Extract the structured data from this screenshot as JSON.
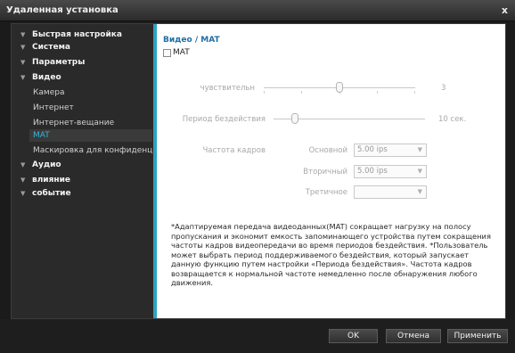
{
  "window": {
    "title": "Удаленная установка",
    "close_glyph": "x"
  },
  "sidebar": {
    "items": [
      {
        "label": "Быстрая настройка",
        "type": "category"
      },
      {
        "label": "Система",
        "type": "category"
      },
      {
        "label": "Параметры",
        "type": "category"
      },
      {
        "label": "Видео",
        "type": "category"
      },
      {
        "label": "Камера",
        "type": "sub"
      },
      {
        "label": "Интернет",
        "type": "sub"
      },
      {
        "label": "Интернет-вещание",
        "type": "sub"
      },
      {
        "label": "MAT",
        "type": "sub",
        "selected": true
      },
      {
        "label": "Маскировка для конфиденци",
        "type": "sub"
      },
      {
        "label": "Аудио",
        "type": "category"
      },
      {
        "label": "влияние",
        "type": "category"
      },
      {
        "label": "событие",
        "type": "category"
      }
    ]
  },
  "main": {
    "heading": "Видео / MAT",
    "mat_checkbox": {
      "label": "MAT",
      "checked": false
    },
    "sensitivity": {
      "label": "чувствительн",
      "value": "3",
      "level": 3,
      "min": 1,
      "max": 5
    },
    "idle_period": {
      "label": "Период бездействия",
      "value": "10",
      "unit": "сек.",
      "level": 10,
      "min": 10,
      "max": 300
    },
    "frame_rate": {
      "label": "Частота кадров",
      "primary": {
        "label": "Основной",
        "value": "5.00 ips"
      },
      "secondary": {
        "label": "Вторичный",
        "value": "5.00 ips"
      },
      "tertiary": {
        "label": "Третичное",
        "value": ""
      }
    },
    "note": "*Адаптируемая передача видеоданных(MAT) сокращает нагрузку на полосу пропускания и экономит емкость запоминающего устройства путем сокращения частоты кадров видеопередачи во время периодов бездействия. *Пользователь может выбрать период поддерживаемого бездействия, который запускает данную функцию путем настройки «Периода бездействия». Частота кадров возвращается к нормальной частоте немедленно после обнаружения любого движения."
  },
  "buttons": {
    "ok": "OK",
    "cancel": "Отмена",
    "apply": "Применить"
  },
  "colors": {
    "accent": "#2aa3c2",
    "selected_text": "#38b6d6",
    "heading": "#1e6fa5"
  }
}
